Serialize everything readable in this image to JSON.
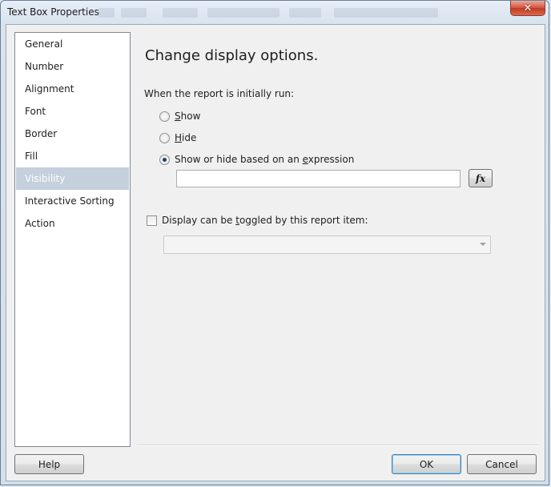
{
  "window": {
    "title": "Text Box Properties",
    "close_glyph": "✕"
  },
  "nav": {
    "items": [
      {
        "label": "General"
      },
      {
        "label": "Number"
      },
      {
        "label": "Alignment"
      },
      {
        "label": "Font"
      },
      {
        "label": "Border"
      },
      {
        "label": "Fill"
      },
      {
        "label": "Visibility",
        "selected": true
      },
      {
        "label": "Interactive Sorting"
      },
      {
        "label": "Action"
      }
    ]
  },
  "main": {
    "heading": "Change display options.",
    "initial_label": "When the report is initially run:",
    "options": {
      "show": {
        "pre": "",
        "key": "S",
        "post": "how",
        "checked": false
      },
      "hide": {
        "pre": "",
        "key": "H",
        "post": "ide",
        "checked": false
      },
      "expression": {
        "pre": "Show or hide based on an ",
        "key": "e",
        "post": "xpression",
        "checked": true
      }
    },
    "expression_value": "",
    "fx_label": "fx",
    "toggle": {
      "pre": "Display can be ",
      "key": "t",
      "post": "oggled by this report item:",
      "checked": false,
      "selected_value": ""
    }
  },
  "footer": {
    "help_label": "Help",
    "ok_label": "OK",
    "cancel_label": "Cancel"
  },
  "colors": {
    "selected_nav_bg": "#c4d0dc",
    "close_button": "#c7442a"
  }
}
